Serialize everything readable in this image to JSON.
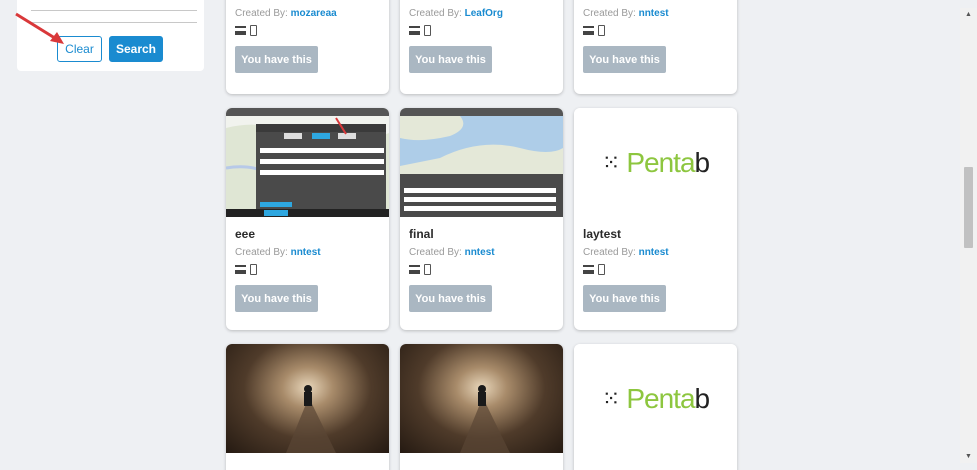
{
  "filter": {
    "clear_label": "Clear",
    "search_label": "Search"
  },
  "created_by_prefix": "Created By: ",
  "have_label": "You have this",
  "row1": [
    {
      "author": "mozareaa"
    },
    {
      "author": "LeafOrg"
    },
    {
      "author": "nntest"
    }
  ],
  "row2": [
    {
      "title": "eee",
      "author": "nntest",
      "thumb": "map"
    },
    {
      "title": "final",
      "author": "nntest",
      "thumb": "map"
    },
    {
      "title": "laytest",
      "author": "nntest",
      "thumb": "logo"
    }
  ],
  "row3": [
    {
      "thumb": "forest"
    },
    {
      "thumb": "forest"
    },
    {
      "thumb": "logo"
    }
  ],
  "logo": {
    "dots": "⁙",
    "left": "Penta",
    "right": "b"
  },
  "colors": {
    "accent": "#1a8bd0",
    "disabled": "#aab7c2",
    "logo_green": "#8dc63f"
  }
}
